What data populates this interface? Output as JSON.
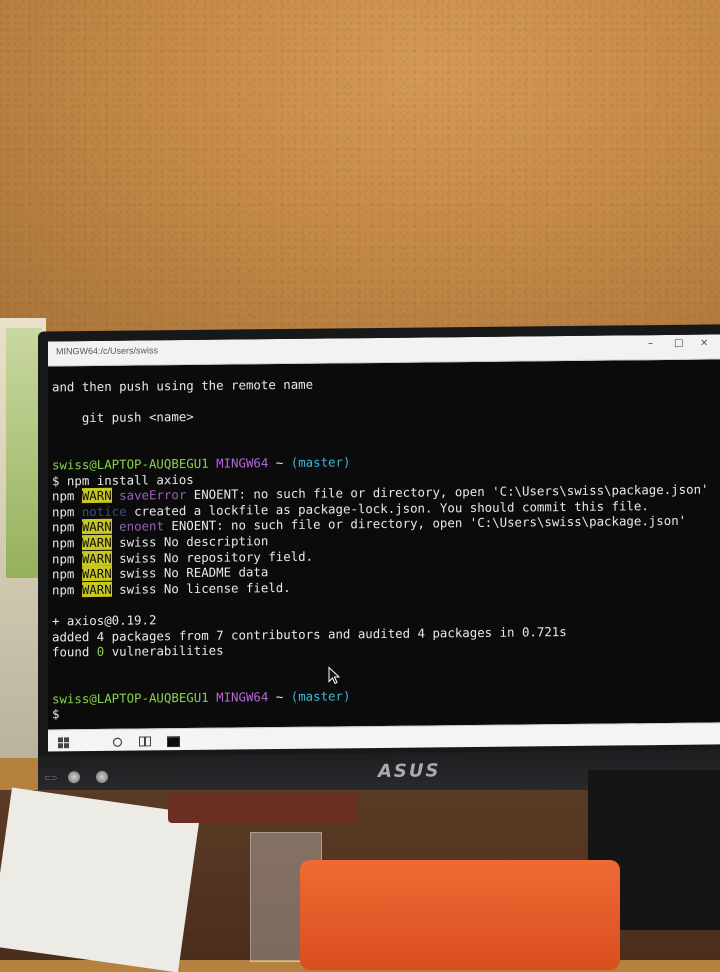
{
  "window": {
    "title": "MINGW64:/c/Users/swiss",
    "controls": [
      "–",
      "□",
      "×"
    ]
  },
  "terminal": {
    "lines": [
      {
        "segments": [
          {
            "t": "and then push using the remote name",
            "c": ""
          }
        ]
      },
      {
        "segments": [
          {
            "t": "",
            "c": ""
          }
        ]
      },
      {
        "segments": [
          {
            "t": "    git push <name>",
            "c": ""
          }
        ]
      },
      {
        "segments": [
          {
            "t": "",
            "c": ""
          }
        ]
      },
      {
        "segments": [
          {
            "t": "",
            "c": ""
          }
        ]
      },
      {
        "segments": [
          {
            "t": "swiss@LAPTOP-AUQBEGU1 ",
            "c": "green-t"
          },
          {
            "t": "MINGW64 ",
            "c": "purple-t"
          },
          {
            "t": "~ ",
            "c": ""
          },
          {
            "t": "(master)",
            "c": "cyan-t"
          }
        ]
      },
      {
        "segments": [
          {
            "t": "$ npm install axios",
            "c": ""
          }
        ]
      },
      {
        "segments": [
          {
            "t": "npm ",
            "c": ""
          },
          {
            "t": "WARN",
            "c": "warn-badge"
          },
          {
            "t": " ",
            "c": ""
          },
          {
            "t": "saveError",
            "c": "dim-mag"
          },
          {
            "t": " ENOENT: no such file or directory, open 'C:\\Users\\swiss\\package.json'",
            "c": ""
          }
        ]
      },
      {
        "segments": [
          {
            "t": "npm ",
            "c": ""
          },
          {
            "t": "notice",
            "c": "notice-t"
          },
          {
            "t": " created a lockfile as package-lock.json. You should commit this file.",
            "c": ""
          }
        ]
      },
      {
        "segments": [
          {
            "t": "npm ",
            "c": ""
          },
          {
            "t": "WARN",
            "c": "warn-badge"
          },
          {
            "t": " ",
            "c": ""
          },
          {
            "t": "enoent",
            "c": "dim-mag"
          },
          {
            "t": " ENOENT: no such file or directory, open 'C:\\Users\\swiss\\package.json'",
            "c": ""
          }
        ]
      },
      {
        "segments": [
          {
            "t": "npm ",
            "c": ""
          },
          {
            "t": "WARN",
            "c": "warn-badge"
          },
          {
            "t": " swiss No description",
            "c": ""
          }
        ]
      },
      {
        "segments": [
          {
            "t": "npm ",
            "c": ""
          },
          {
            "t": "WARN",
            "c": "warn-badge"
          },
          {
            "t": " swiss No repository field.",
            "c": ""
          }
        ]
      },
      {
        "segments": [
          {
            "t": "npm ",
            "c": ""
          },
          {
            "t": "WARN",
            "c": "warn-badge"
          },
          {
            "t": " swiss No README data",
            "c": ""
          }
        ]
      },
      {
        "segments": [
          {
            "t": "npm ",
            "c": ""
          },
          {
            "t": "WARN",
            "c": "warn-badge"
          },
          {
            "t": " swiss No license field.",
            "c": ""
          }
        ]
      },
      {
        "segments": [
          {
            "t": "",
            "c": ""
          }
        ]
      },
      {
        "segments": [
          {
            "t": "+ axios@0.19.2",
            "c": ""
          }
        ]
      },
      {
        "segments": [
          {
            "t": "added 4 packages from 7 contributors and audited 4 packages in 0.721s",
            "c": ""
          }
        ]
      },
      {
        "segments": [
          {
            "t": "found ",
            "c": ""
          },
          {
            "t": "0",
            "c": "zero-t"
          },
          {
            "t": " vulnerabilities",
            "c": ""
          }
        ]
      },
      {
        "segments": [
          {
            "t": "",
            "c": ""
          }
        ]
      },
      {
        "segments": [
          {
            "t": "",
            "c": ""
          }
        ]
      },
      {
        "segments": [
          {
            "t": "swiss@LAPTOP-AUQBEGU1 ",
            "c": "green-t"
          },
          {
            "t": "MINGW64 ",
            "c": "purple-t"
          },
          {
            "t": "~ ",
            "c": ""
          },
          {
            "t": "(master)",
            "c": "cyan-t"
          }
        ]
      },
      {
        "segments": [
          {
            "t": "$",
            "c": ""
          }
        ]
      }
    ]
  },
  "taskbar": {
    "items": [
      "windows-start-icon",
      "cortana-icon",
      "task-view-icon",
      "mingw-terminal-icon"
    ]
  },
  "monitor": {
    "brand": "ASUS"
  },
  "colors": {
    "prompt_user": "#86d24a",
    "prompt_mingw": "#b565d6",
    "prompt_branch": "#3fb6d8",
    "warn_bg": "#c8c820"
  }
}
